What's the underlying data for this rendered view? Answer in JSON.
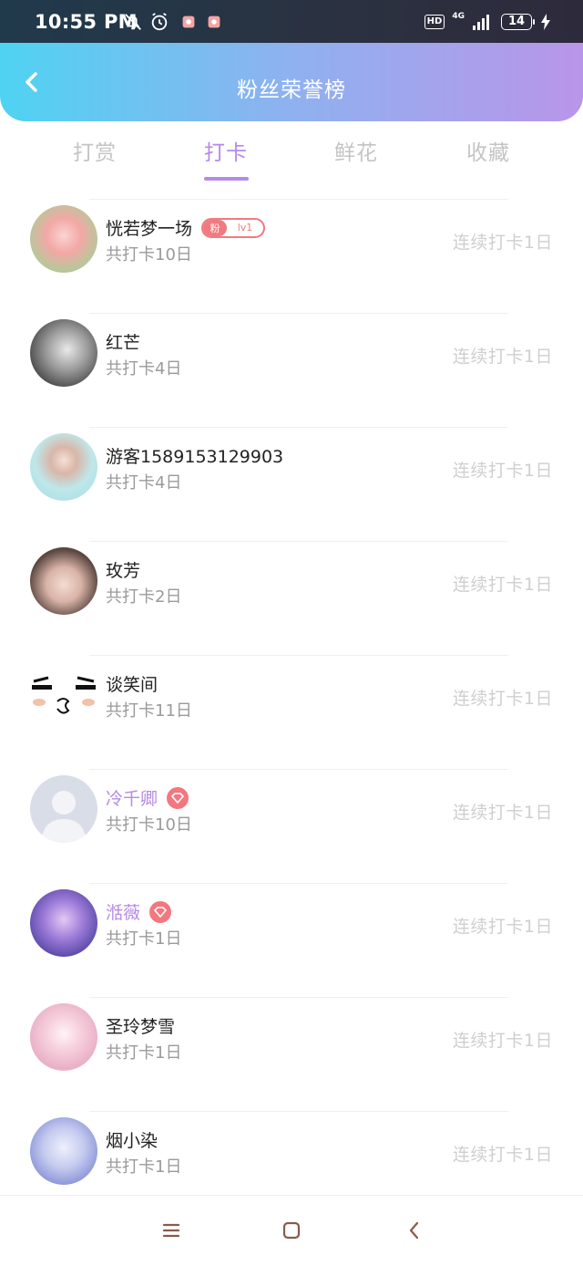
{
  "status_bar": {
    "time": "10:55 PM",
    "hd": "HD",
    "network": "4G",
    "battery": "14"
  },
  "header": {
    "title": "粉丝荣誉榜"
  },
  "tabs": [
    {
      "label": "打赏",
      "active": false
    },
    {
      "label": "打卡",
      "active": true
    },
    {
      "label": "鲜花",
      "active": false
    },
    {
      "label": "收藏",
      "active": false
    }
  ],
  "fan_badge": {
    "left": "粉",
    "right": "lv1"
  },
  "list": [
    {
      "name": "恍若梦一场",
      "total": "共打卡10日",
      "streak": "连续打卡1日"
    },
    {
      "name": "红芒",
      "total": "共打卡4日",
      "streak": "连续打卡1日"
    },
    {
      "name": "游客1589153129903",
      "total": "共打卡4日",
      "streak": "连续打卡1日"
    },
    {
      "name": "玫芳",
      "total": "共打卡2日",
      "streak": "连续打卡1日"
    },
    {
      "name": "谈笑间",
      "total": "共打卡11日",
      "streak": "连续打卡1日"
    },
    {
      "name": "冷千卿",
      "total": "共打卡10日",
      "streak": "连续打卡1日"
    },
    {
      "name": "湉薇",
      "total": "共打卡1日",
      "streak": "连续打卡1日"
    },
    {
      "name": "圣玲梦雪",
      "total": "共打卡1日",
      "streak": "连续打卡1日"
    },
    {
      "name": "烟小染",
      "total": "共打卡1日",
      "streak": "连续打卡1日"
    }
  ],
  "colors": {
    "accent": "#b58ae6",
    "badge": "#f07a80",
    "header_start": "#4fd3f2",
    "header_end": "#b995e9"
  },
  "icons": [
    "bell-off-icon",
    "alarm-icon",
    "app-notify-icon",
    "back-arrow-icon",
    "diamond-icon",
    "menu-icon",
    "home-icon",
    "back-icon"
  ]
}
